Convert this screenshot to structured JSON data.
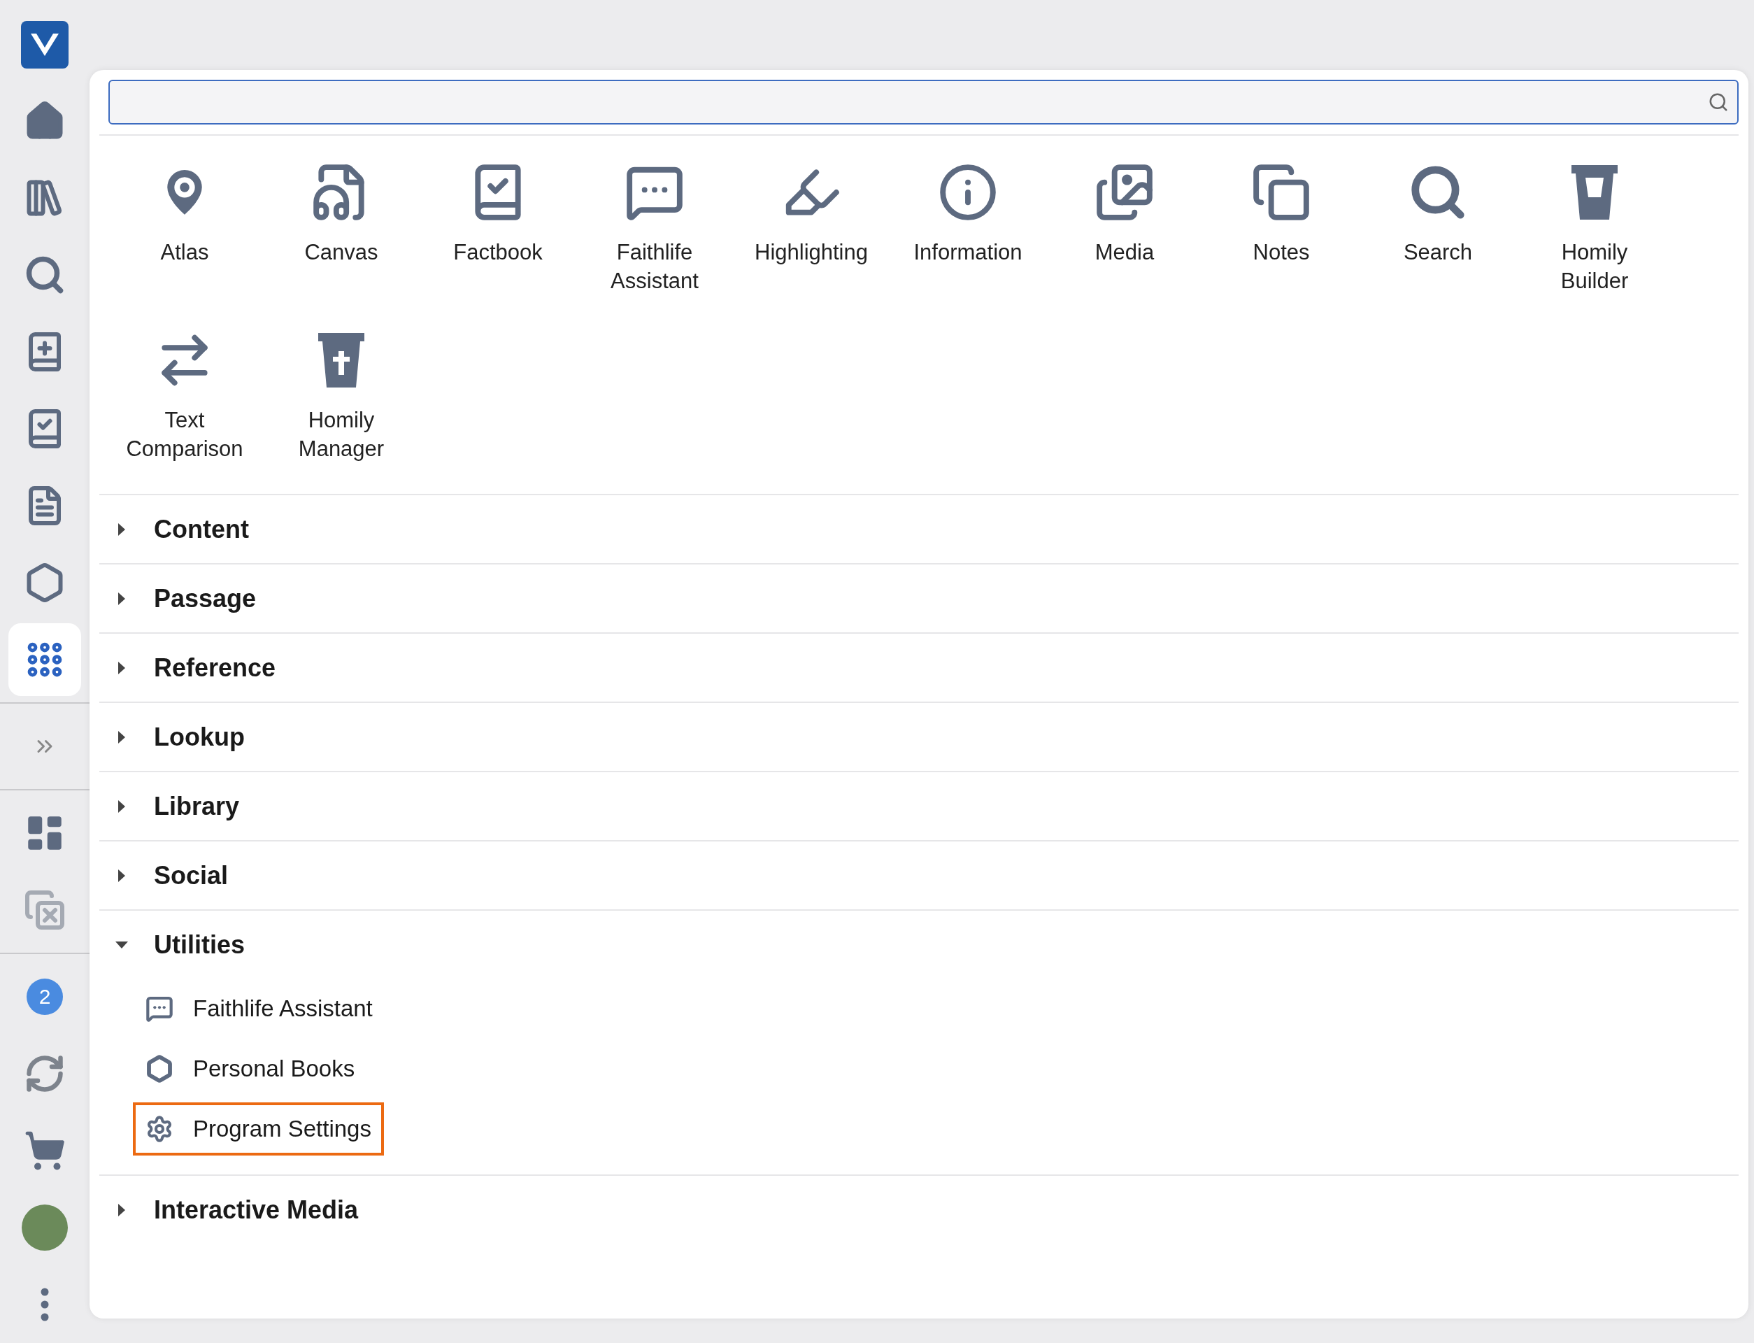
{
  "sidebar": {
    "items": [
      {
        "selected": false
      },
      {
        "selected": false
      },
      {
        "selected": false
      },
      {
        "selected": false
      },
      {
        "selected": false
      },
      {
        "selected": false
      },
      {
        "selected": false
      },
      {
        "selected": true
      }
    ],
    "expand": {
      "selected": false
    },
    "layout_items": [
      {
        "selected": false
      },
      {
        "selected": false
      }
    ],
    "notification": {
      "badge": "2"
    }
  },
  "tools": [
    {
      "label": "Atlas"
    },
    {
      "label": "Canvas"
    },
    {
      "label": "Factbook"
    },
    {
      "label": "Faithlife Assistant"
    },
    {
      "label": "Highlighting"
    },
    {
      "label": "Information"
    },
    {
      "label": "Media"
    },
    {
      "label": "Notes"
    },
    {
      "label": "Search"
    },
    {
      "label": "Homily Builder"
    },
    {
      "label": "Text Comparison"
    },
    {
      "label": "Homily Manager"
    }
  ],
  "sections": [
    {
      "title": "Content",
      "expanded": false
    },
    {
      "title": "Passage",
      "expanded": false
    },
    {
      "title": "Reference",
      "expanded": false
    },
    {
      "title": "Lookup",
      "expanded": false
    },
    {
      "title": "Library",
      "expanded": false
    },
    {
      "title": "Social",
      "expanded": false
    },
    {
      "title": "Utilities",
      "expanded": true,
      "children": [
        {
          "label": "Faithlife Assistant",
          "highlighted": false
        },
        {
          "label": "Personal Books",
          "highlighted": false
        },
        {
          "label": "Program Settings",
          "highlighted": true
        }
      ]
    },
    {
      "title": "Interactive Media",
      "expanded": false
    }
  ]
}
